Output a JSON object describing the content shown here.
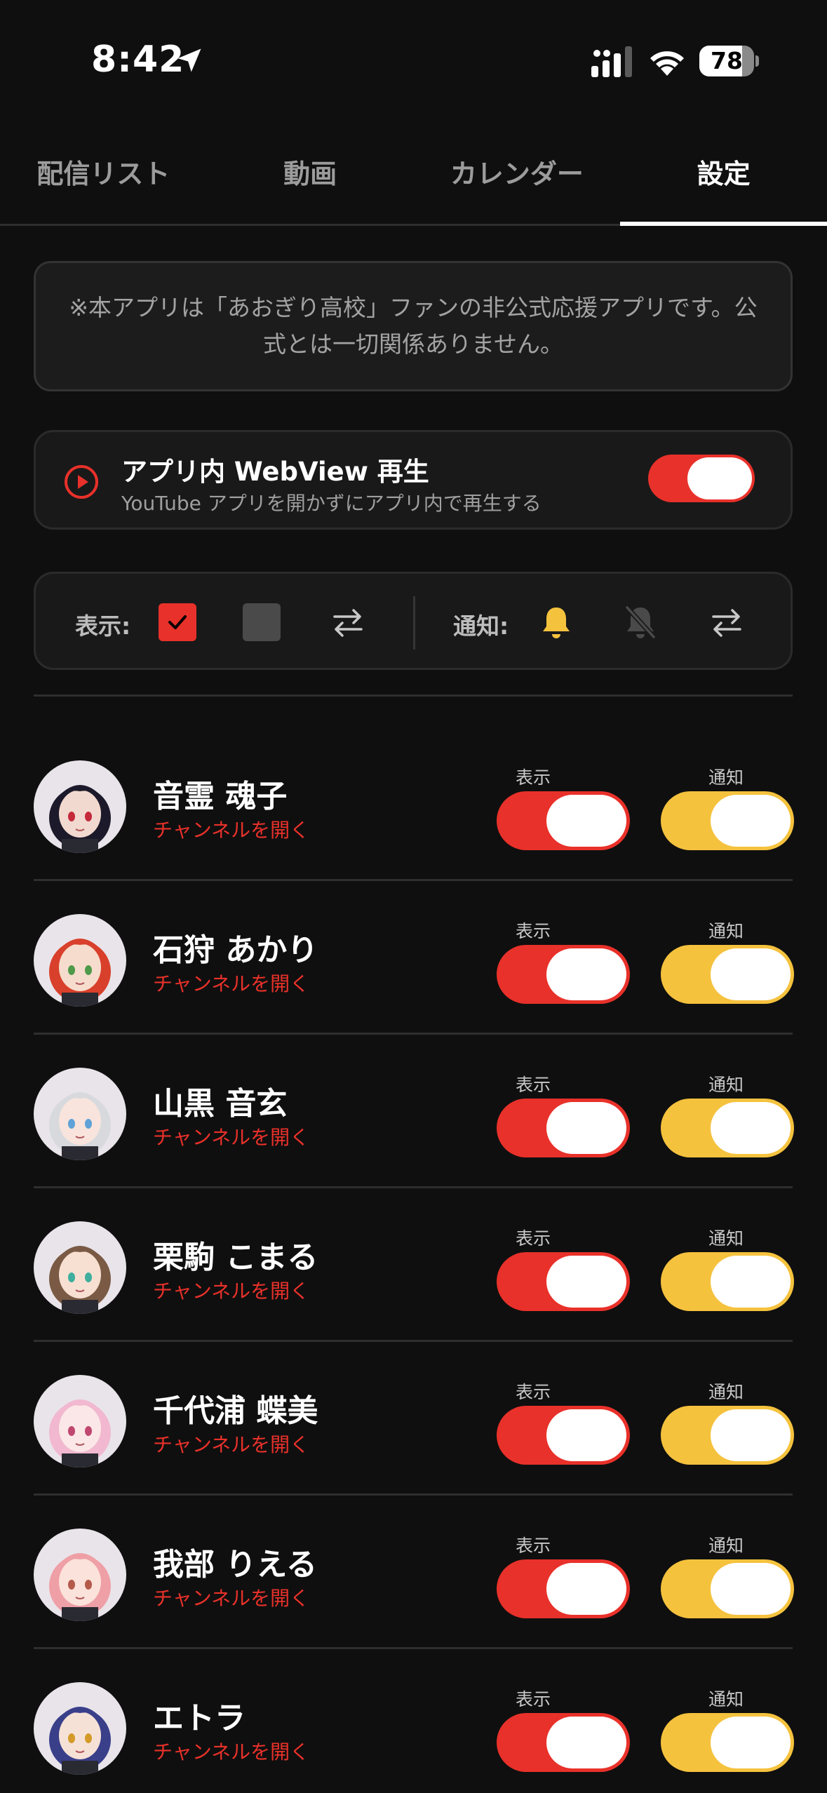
{
  "status": {
    "time": "8:42",
    "battery": "78",
    "battery_level": 0.78
  },
  "tabs": [
    {
      "label": "配信リスト",
      "active": false
    },
    {
      "label": "動画",
      "active": false
    },
    {
      "label": "カレンダー",
      "active": false
    },
    {
      "label": "設定",
      "active": true
    }
  ],
  "notice": "※本アプリは「あおぎり高校」ファンの非公式応援アプリです。公式とは一切関係ありません。",
  "webview": {
    "title": "アプリ内 WebView 再生",
    "subtitle": "YouTube アプリを開かずにアプリ内で再生する",
    "enabled": true
  },
  "filters": {
    "display_label": "表示:",
    "notify_label": "通知:"
  },
  "talents": [
    {
      "name": "音霊 魂子",
      "link": "チャンネルを開く",
      "display_label": "表示",
      "notify_label": "通知",
      "display_on": true,
      "notify_on": true,
      "avatar_hair": "#1c1a2a",
      "avatar_skin": "#f2d9cf",
      "avatar_eye": "#c42a3a"
    },
    {
      "name": "石狩 あかり",
      "link": "チャンネルを開く",
      "display_label": "表示",
      "notify_label": "通知",
      "display_on": true,
      "notify_on": true,
      "avatar_hair": "#d8402b",
      "avatar_skin": "#f6dccd",
      "avatar_eye": "#4f9a4a"
    },
    {
      "name": "山黒 音玄",
      "link": "チャンネルを開く",
      "display_label": "表示",
      "notify_label": "通知",
      "display_on": true,
      "notify_on": true,
      "avatar_hair": "#d7d9dd",
      "avatar_skin": "#f8e4dc",
      "avatar_eye": "#5fa2d8"
    },
    {
      "name": "栗駒 こまる",
      "link": "チャンネルを開く",
      "display_label": "表示",
      "notify_label": "通知",
      "display_on": true,
      "notify_on": true,
      "avatar_hair": "#7a5a44",
      "avatar_skin": "#f7e0d2",
      "avatar_eye": "#3fae9e"
    },
    {
      "name": "千代浦 蝶美",
      "link": "チャンネルを開く",
      "display_label": "表示",
      "notify_label": "通知",
      "display_on": true,
      "notify_on": true,
      "avatar_hair": "#f1b8d0",
      "avatar_skin": "#fbe7e7",
      "avatar_eye": "#c0476f"
    },
    {
      "name": "我部 りえる",
      "link": "チャンネルを開く",
      "display_label": "表示",
      "notify_label": "通知",
      "display_on": true,
      "notify_on": true,
      "avatar_hair": "#ef9fa6",
      "avatar_skin": "#fbe2da",
      "avatar_eye": "#b45a4a"
    },
    {
      "name": "エトラ",
      "link": "チャンネルを開く",
      "display_label": "表示",
      "notify_label": "通知",
      "display_on": true,
      "notify_on": true,
      "avatar_hair": "#3a3f8a",
      "avatar_skin": "#f6e1d6",
      "avatar_eye": "#d49a2a"
    }
  ]
}
